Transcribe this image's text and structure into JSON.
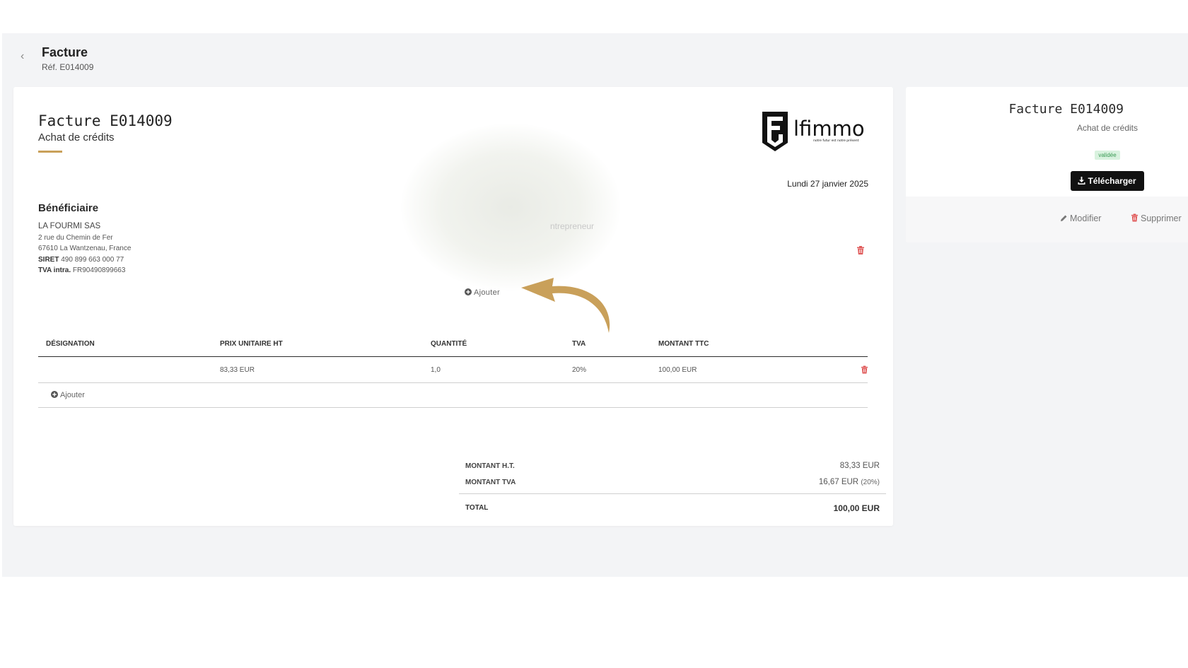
{
  "header": {
    "title": "Facture",
    "ref": "Réf. E014009"
  },
  "invoice": {
    "title": "Facture E014009",
    "subtitle": "Achat de crédits",
    "date": "Lundi 27 janvier 2025",
    "logo_text": "lfimmo",
    "logo_tagline": "notre futur est notre présent",
    "beneficiary": {
      "heading": "Bénéficiaire",
      "name": "LA FOURMI SAS",
      "address1": "2 rue du Chemin de Fer",
      "address2": "67610 La Wantzenau, France",
      "siret_label": "SIRET",
      "siret": "490 899 663 000 77",
      "tva_label": "TVA intra.",
      "tva": "FR90490899663"
    },
    "blurred_fragment": "ntrepreneur",
    "add_label": "Ajouter"
  },
  "table": {
    "headers": [
      "DÉSIGNATION",
      "PRIX UNITAIRE HT",
      "QUANTITÉ",
      "TVA",
      "MONTANT TTC"
    ],
    "rows": [
      {
        "designation": "",
        "unit_price": "83,33 EUR",
        "quantity": "1,0",
        "tva": "20%",
        "amount": "100,00 EUR"
      }
    ],
    "add_label": "Ajouter"
  },
  "totals": {
    "ht_label": "MONTANT H.T.",
    "ht_value": "83,33 EUR",
    "tva_label": "MONTANT TVA",
    "tva_value": "16,67 EUR",
    "tva_rate": "(20%)",
    "total_label": "TOTAL",
    "total_value": "100,00 EUR"
  },
  "side": {
    "title": "Facture E014009",
    "subtitle": "Achat de crédits",
    "status": "validée",
    "download": "Télécharger",
    "edit": "Modifier",
    "delete": "Supprimer"
  },
  "colors": {
    "accent": "#c9a05a",
    "danger": "#e05a5a",
    "success_bg": "#d9f2df",
    "success_text": "#3a9a54"
  }
}
